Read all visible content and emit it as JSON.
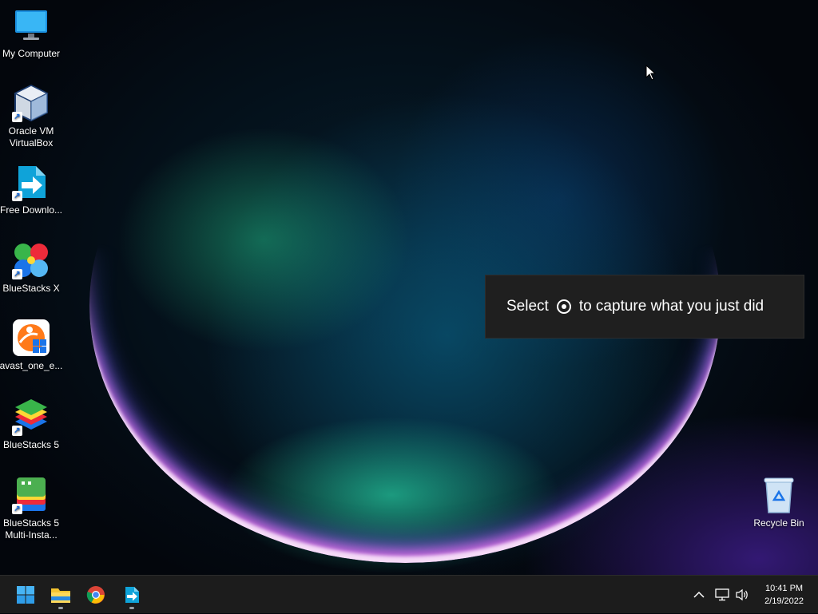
{
  "desktop": {
    "icons": [
      {
        "label": "My Computer",
        "icon": "monitor-icon"
      },
      {
        "label": "Oracle VM VirtualBox",
        "icon": "virtualbox-icon"
      },
      {
        "label": "Free Downlo...",
        "icon": "download-manager-icon"
      },
      {
        "label": "BlueStacks X",
        "icon": "bluestacks-x-icon"
      },
      {
        "label": "avast_one_e...",
        "icon": "avast-icon"
      },
      {
        "label": "BlueStacks 5",
        "icon": "bluestacks-5-icon"
      },
      {
        "label": "BlueStacks 5 Multi-Insta...",
        "icon": "bluestacks-multi-instance-icon"
      },
      {
        "label": "Recycle Bin",
        "icon": "recycle-bin-icon"
      }
    ]
  },
  "toast": {
    "prefix": "Select",
    "icon": "record-icon",
    "suffix": "to capture what you just did"
  },
  "taskbar": {
    "items": [
      {
        "name": "Start",
        "icon": "windows-start-icon"
      },
      {
        "name": "File Explorer",
        "icon": "folder-icon"
      },
      {
        "name": "Google Chrome",
        "icon": "chrome-icon"
      },
      {
        "name": "Free Download Manager",
        "icon": "download-manager-icon"
      }
    ],
    "tray": {
      "icons": [
        "chevron-up-icon",
        "network-icon",
        "volume-icon"
      ],
      "time": "10:41 PM",
      "date": "2/19/2022"
    }
  },
  "colors": {
    "taskbar": "#1c1c1c",
    "toast": "#1f1f1f",
    "accent": "#1b6bd8"
  }
}
